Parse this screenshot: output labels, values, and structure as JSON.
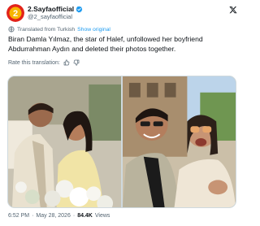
{
  "header": {
    "display_name": "2.Sayfaofficial",
    "handle": "@2_sayfaofficial",
    "avatar_label": "2",
    "verified_color": "#1d9bf0"
  },
  "translation": {
    "note": "Translated from Turkish",
    "link": "Show original"
  },
  "tweet": {
    "text": "Biran Damla Yılmaz, the star of Halef, unfollowed her boyfriend Abdurrahman Aydın and deleted their photos together."
  },
  "rate": {
    "label": "Rate this translation:"
  },
  "meta": {
    "time": "6:52 PM",
    "separator": "·",
    "date": "May 28, 2026",
    "views_count": "84.4K",
    "views_label": "Views"
  },
  "colors": {
    "accent": "#1d9bf0",
    "muted": "#536471",
    "brand_red": "#e2231a",
    "brand_yellow": "#f7b500"
  }
}
